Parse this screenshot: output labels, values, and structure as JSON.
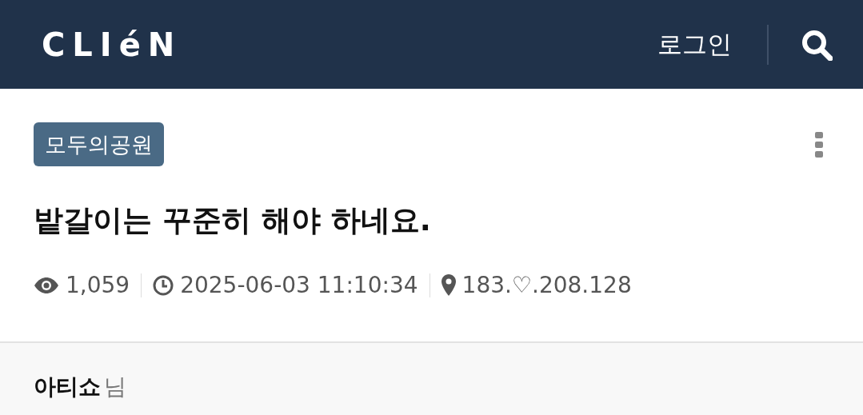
{
  "header": {
    "logo": "CLIéN",
    "login": "로그인"
  },
  "post": {
    "board": "모두의공원",
    "title": "밭갈이는 꾸준히 해야 하네요.",
    "meta": [
      {
        "kind": "views",
        "text": "1,059"
      },
      {
        "kind": "time",
        "text": "2025-06-03 11:10:34"
      },
      {
        "kind": "ip",
        "text": "183.♡.208.128"
      }
    ]
  },
  "author": {
    "name": "아티쇼",
    "suffix": "님"
  }
}
